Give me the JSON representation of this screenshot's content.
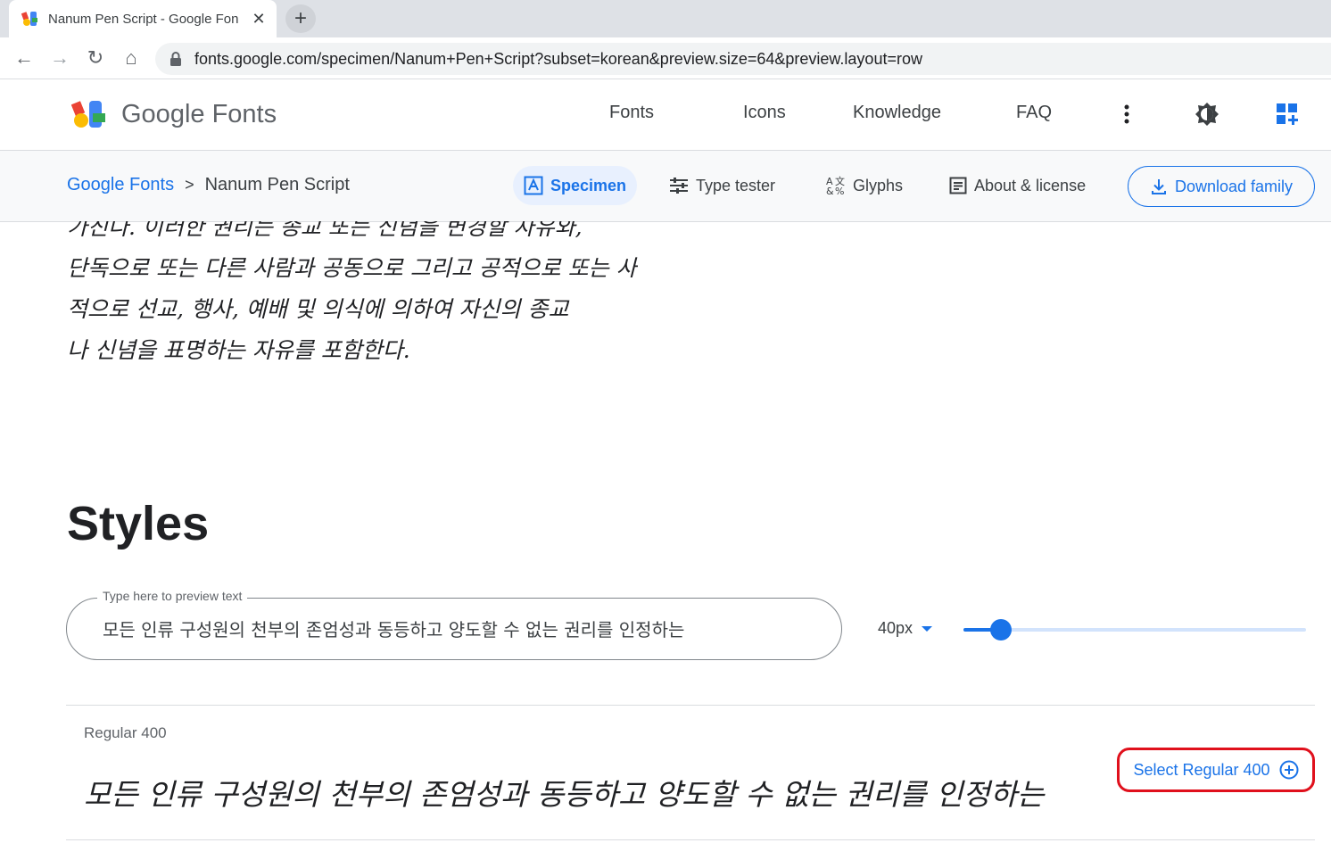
{
  "browser": {
    "tab_title": "Nanum Pen Script - Google Fon",
    "close_glyph": "✕",
    "newtab_glyph": "+",
    "url": "fonts.google.com/specimen/Nanum+Pen+Script?subset=korean&preview.size=64&preview.layout=row",
    "back_glyph": "←",
    "forward_glyph": "→",
    "reload_glyph": "↻",
    "home_glyph": "⌂"
  },
  "header": {
    "logo_text": "Google Fonts",
    "nav": [
      "Fonts",
      "Icons",
      "Knowledge",
      "FAQ"
    ]
  },
  "subheader": {
    "breadcrumb_root": "Google Fonts",
    "breadcrumb_sep": ">",
    "breadcrumb_current": "Nanum Pen Script",
    "tabs": [
      "Specimen",
      "Type tester",
      "Glyphs",
      "About & license"
    ],
    "download_label": "Download family"
  },
  "content": {
    "paragraph_lines": [
      "가진다. 이러한 권리는 종교 또는 신념을 변경할 자유와,",
      "단독으로 또는 다른 사람과 공동으로 그리고 공적으로 또는 사",
      "적으로 선교, 행사, 예배 및 의식에 의하여 자신의 종교",
      "나 신념을 표명하는 자유를 포함한다."
    ],
    "styles_title": "Styles",
    "preview_label": "Type here to preview text",
    "preview_value": "모든 인류 구성원의 천부의 존엄성과 동등하고 양도할 수 없는 권리를 인정하는",
    "size_label": "40px",
    "size_slider_fraction": 0.11,
    "style_name": "Regular 400",
    "style_sample": "모든 인류 구성원의 천부의 존엄성과 동등하고 양도할 수 없는 권리를 인정하는",
    "select_label": "Select Regular 400"
  },
  "colors": {
    "accent": "#1a73e8",
    "highlight_box": "#e0101c"
  }
}
